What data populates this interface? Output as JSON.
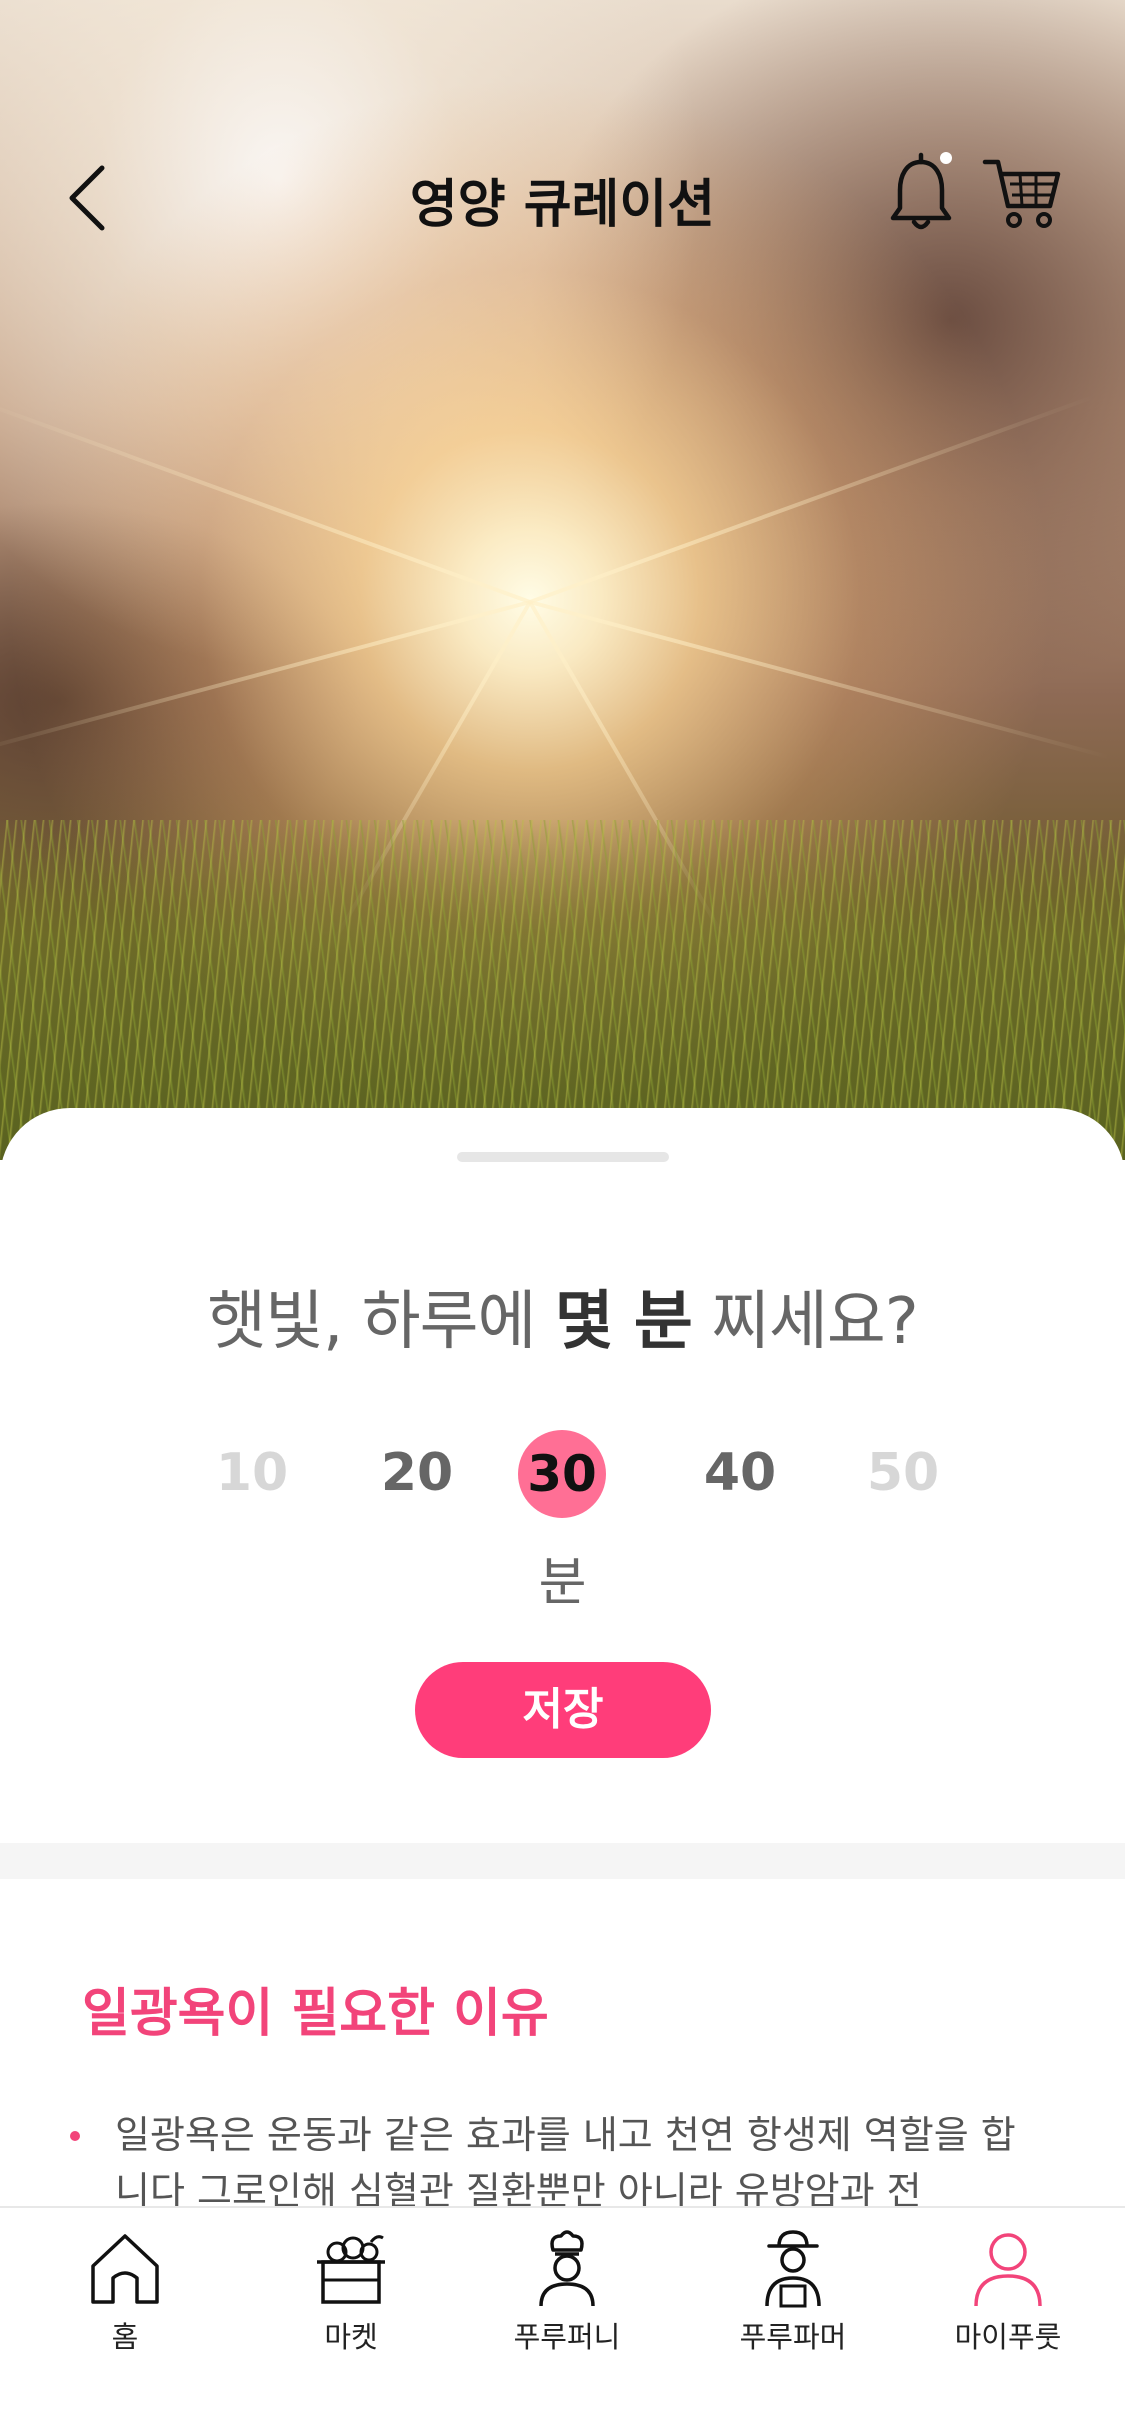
{
  "header": {
    "title": "영양 큐레이션"
  },
  "sheet": {
    "question_prefix": "햇빛, 하루에 ",
    "question_bold": "몇 분",
    "question_suffix": " 찌세요?",
    "picker_options": [
      "10",
      "20",
      "30",
      "40",
      "50"
    ],
    "selected_value": "30",
    "unit": "분",
    "save_label": "저장"
  },
  "info": {
    "title": "일광욕이 필요한 이유",
    "bullets": [
      "일광욕은 운동과 같은 효과를 내고 천연 항생제 역할을 합니다 그로인해 심혈관 질환뿐만 아니라 유방암과 전"
    ]
  },
  "tabbar": {
    "tabs": [
      {
        "label": "홈",
        "icon": "home-icon"
      },
      {
        "label": "마켓",
        "icon": "market-basket-icon"
      },
      {
        "label": "푸루퍼니",
        "icon": "chef-icon"
      },
      {
        "label": "푸루파머",
        "icon": "farmer-icon"
      },
      {
        "label": "마이푸룻",
        "icon": "user-icon"
      }
    ],
    "active_tab": "마이푸룻",
    "active_color": "#f2447a"
  },
  "colors": {
    "accent": "#ff3d7a",
    "selected_circle": "#ff6f95"
  }
}
